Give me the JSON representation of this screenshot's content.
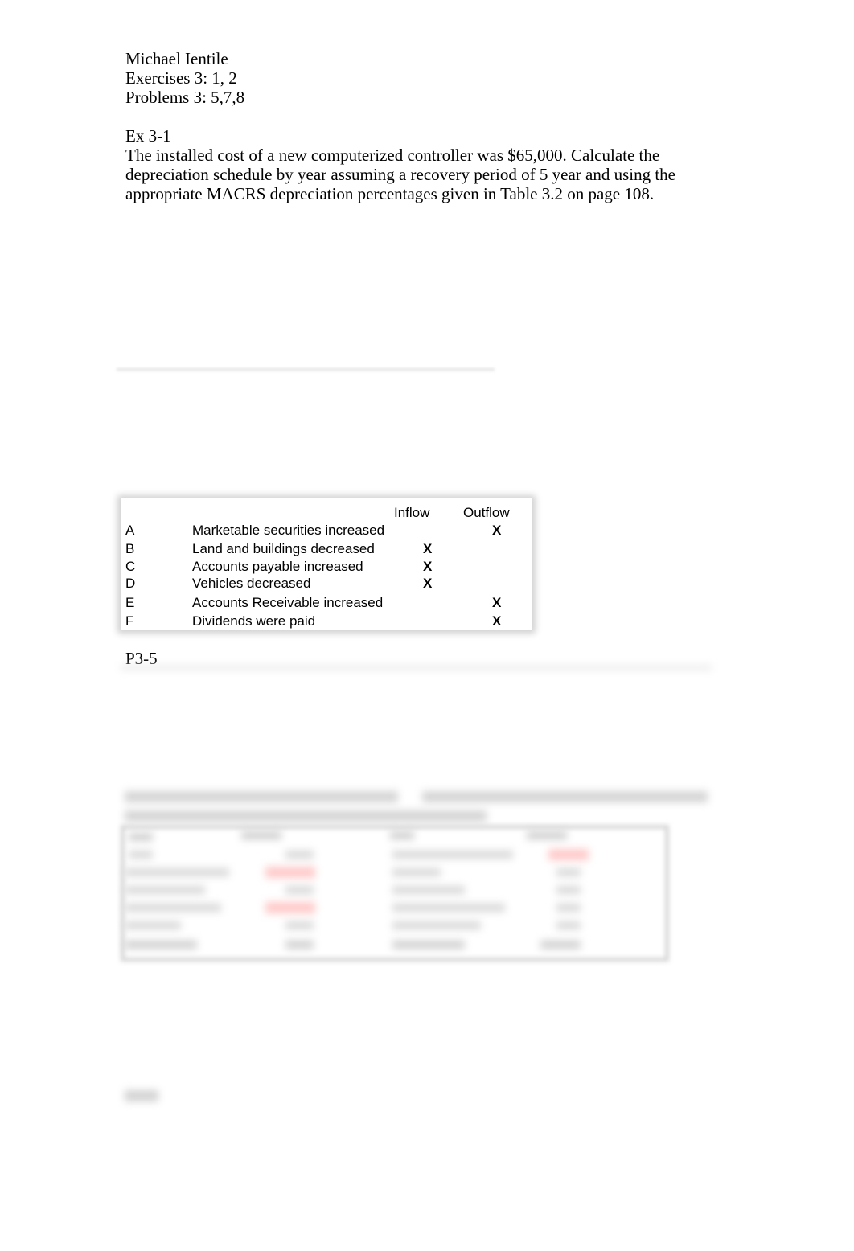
{
  "header": {
    "name": "Michael Ientile",
    "exercises": "Exercises 3: 1, 2",
    "problems": "Problems 3: 5,7,8"
  },
  "exercise_3_1": {
    "label": "Ex 3-1",
    "lines": [
      "The installed cost of a new computerized controller was $65,000. Calculate the",
      "depreciation schedule by year assuming a recovery period of 5 year and using the",
      "appropriate MACRS depreciation percentages given in Table 3.2 on page 108."
    ]
  },
  "cash_flow_table": {
    "headers": {
      "inflow": "Inflow",
      "outflow": "Outflow"
    },
    "mark": "X",
    "rows": [
      {
        "letter": "A",
        "item": "Marketable securities increased",
        "inflow": false,
        "outflow": true
      },
      {
        "letter": "B",
        "item": "Land and buildings decreased",
        "inflow": true,
        "outflow": false
      },
      {
        "letter": "C",
        "item": "Accounts payable increased",
        "inflow": true,
        "outflow": false
      },
      {
        "letter": "D",
        "item": "Vehicles decreased",
        "inflow": true,
        "outflow": false
      },
      {
        "letter": "E",
        "item": "Accounts Receivable increased",
        "inflow": false,
        "outflow": true
      },
      {
        "letter": "F",
        "item": "Dividends were paid",
        "inflow": false,
        "outflow": true
      }
    ]
  },
  "problem_3_5": {
    "label": "P3-5"
  }
}
